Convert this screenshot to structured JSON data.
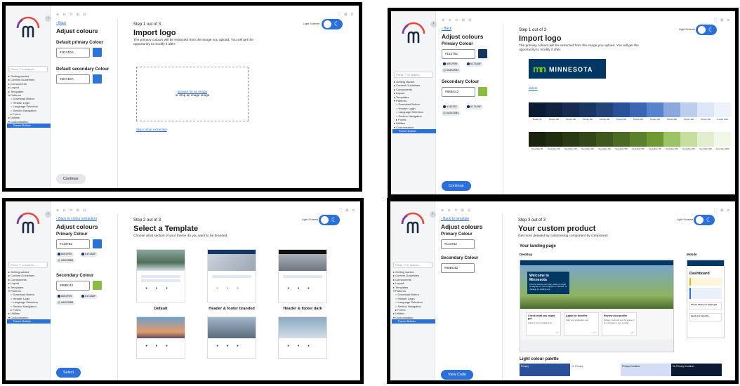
{
  "common": {
    "search_placeholder": "Press \"/\" to search...",
    "toolbar_left": "⊕ ⊖ ⟲  ⊞ ⊟",
    "toolbar_right": "⛶ ⊠ ⊡",
    "nav": [
      {
        "label": "▸ Getting started",
        "level": 0
      },
      {
        "label": "▸ Content Guidelines",
        "level": 0
      },
      {
        "label": "▸ Components",
        "level": 0
      },
      {
        "label": "▸ Layout",
        "level": 0
      },
      {
        "label": "▸ Templates",
        "level": 0
      },
      {
        "label": "▾ Patterns",
        "level": 0
      },
      {
        "label": "○ Download Button",
        "level": 1
      },
      {
        "label": "○ Header Login",
        "level": 1
      },
      {
        "label": "○ Language Selection",
        "level": 1
      },
      {
        "label": "○ Section Navigation",
        "level": 1
      },
      {
        "label": "▸ Forms",
        "level": 1
      },
      {
        "label": "▸ Utilities",
        "level": 0
      },
      {
        "label": "▾ Customisation",
        "level": 0
      },
      {
        "label": "Theme Builder",
        "level": 2,
        "active": true
      }
    ],
    "light_scheme_label": "Light Scheme",
    "colors": {
      "accent": "#2B6FD9",
      "navy": "#143762",
      "green": "#88BC42"
    }
  },
  "s1": {
    "back": "Back",
    "title": "Adjust colours",
    "primary_label": "Default primary Colour",
    "primary_value": "#2D74DA",
    "secondary_label": "Default secondary Colour",
    "secondary_value": "#2D74DA",
    "button": "Continue",
    "step": "Step 1 out of 3",
    "main_title": "Import logo",
    "main_sub": "The primary colours will be extracted from the image you upload. You will get the opportunity to modify it after.",
    "browse": "Browse for an image",
    "drop_text": "or drop an image image",
    "skip": "Skip colour extraction"
  },
  "s2": {
    "back": "Back",
    "title": "Adjust colours",
    "primary_label": "Primary Colour",
    "primary_value": "#143762",
    "primary_chips": [
      "#0E2F59",
      "#173A5F",
      "#ADCBB4"
    ],
    "secondary_label": "Secondary Colour",
    "secondary_value": "#88BC42",
    "secondary_chips": [
      "#143762",
      "#171A5F",
      "#ADCBB4"
    ],
    "button": "Continue",
    "step": "Step 1 out of 3",
    "main_title": "Import logo",
    "main_sub": "The primary colours will be extracted from the image you upload. You will get the opportunity to modify it after.",
    "logo_text": "MINNESOTA",
    "logo_mark": "mn",
    "delete": "delete",
    "primary_palette": [
      {
        "label": "Primary 50",
        "color": "#0b1a33"
      },
      {
        "label": "Primary 100",
        "color": "#10223f"
      },
      {
        "label": "Primary 200",
        "color": "#152b4f"
      },
      {
        "label": "Primary 300",
        "color": "#1b3562"
      },
      {
        "label": "Primary 400",
        "color": "#22427a"
      },
      {
        "label": "Primary 500",
        "color": "#2a5197"
      },
      {
        "label": "Primary 600",
        "color": "#3a66b5"
      },
      {
        "label": "Primary 700",
        "color": "#5782cc"
      },
      {
        "label": "Primary 800",
        "color": "#8aa8de"
      },
      {
        "label": "Primary 900",
        "color": "#bccdee"
      },
      {
        "label": "Primary 950",
        "color": "#dde6f7"
      },
      {
        "label": "Primary 1000",
        "color": "#eef2fb"
      }
    ],
    "secondary_palette": [
      {
        "label": "Secondary 50",
        "color": "#1a230c"
      },
      {
        "label": "Secondary 100",
        "color": "#212d0f"
      },
      {
        "label": "Secondary 200",
        "color": "#2a3a13"
      },
      {
        "label": "Secondary 300",
        "color": "#334818"
      },
      {
        "label": "Secondary 400",
        "color": "#3e581d"
      },
      {
        "label": "Secondary 500",
        "color": "#4b6b23"
      },
      {
        "label": "Secondary 600",
        "color": "#5b812b"
      },
      {
        "label": "Secondary 700",
        "color": "#6e9a34"
      },
      {
        "label": "Secondary 800",
        "color": "#9cc465"
      },
      {
        "label": "Secondary 900",
        "color": "#c6df9f"
      },
      {
        "label": "Secondary 950",
        "color": "#e2efcf"
      },
      {
        "label": "Secondary 1000",
        "color": "#f2f8e8"
      }
    ]
  },
  "s3": {
    "back": "Back to colour extraction",
    "title": "Adjust colours",
    "primary_label": "Primary Colour",
    "primary_value": "#143762",
    "primary_chips": [
      "#0E2F59",
      "#173A5F",
      "#ADCBB4"
    ],
    "secondary_label": "Secondary Colour",
    "secondary_value": "#88BC42",
    "secondary_chips": [
      "#0E2F59",
      "#173A5F",
      "#ADCBB4"
    ],
    "button": "Select",
    "step": "Step 2 out of 3",
    "main_title": "Select a Template",
    "main_sub": "Choose what section of your theme do you want to be branded.",
    "templates": [
      "Default",
      "Header & footer branded",
      "Header & footer dark"
    ]
  },
  "s4": {
    "back": "Back to template",
    "title": "Adjust colours",
    "primary_label": "Primary Colour",
    "primary_value": "#143762",
    "secondary_label": "Secondary Colour",
    "secondary_value": "#88BC42",
    "button": "View Code",
    "step": "Step 3 out of 3",
    "main_title": "Your custom product",
    "main_sub": "Get more detailed by customising component by component.",
    "landing": "Your landing page",
    "desktop": "Desktop",
    "mobile": "Mobile",
    "welcome_title": "Welcome to Minnesota",
    "welcome_sub": "Find out how we can help, what you might be eligible for, how to apply for a benefit, or manage an existing one.",
    "cards": [
      {
        "title": "Check what you might get",
        "sub": "Check if you're eligible now"
      },
      {
        "title": "Apply for benefits",
        "sub": "Start your application now"
      },
      {
        "title": "Review your profile",
        "sub": "Review, track and see the status of any changes in your benefits"
      }
    ],
    "mobile_title": "Dashboard",
    "mobile_card1": "Check what you might get",
    "mobile_card2": "Apply for benefits",
    "palette_title": "Light colour palette",
    "palette": [
      {
        "label": "Primary",
        "color": "#2a5197",
        "fg": "#ffffff"
      },
      {
        "label": "On Primary",
        "color": "#ffffff",
        "fg": "#2a5197"
      },
      {
        "label": "Primary Container",
        "color": "#d3ddf6",
        "fg": "#0b1a33"
      },
      {
        "label": "On Primary Container",
        "color": "#0b1a33",
        "fg": "#ffffff"
      }
    ]
  }
}
